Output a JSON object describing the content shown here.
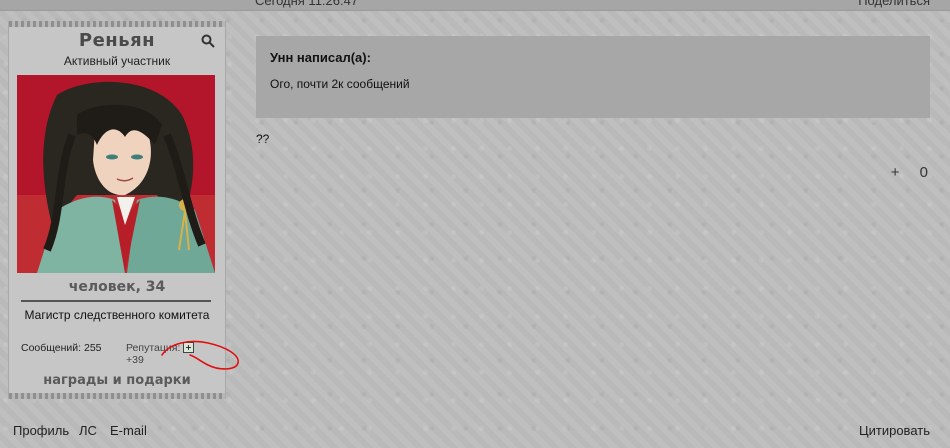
{
  "topbar": {
    "left_text": "Сегодня 11:26:47",
    "right_text": "Поделиться"
  },
  "profile": {
    "name": "Реньян",
    "rank": "Активный участник",
    "species": "человек, 34",
    "title": "Магистр следственного комитета",
    "posts_label": "Сообщений: 255",
    "reputation_label": "Репутация:",
    "reputation_value": "+39",
    "awards_label": "награды и подарки"
  },
  "post": {
    "quote_author": "Унн написал(а):",
    "quote_text": "Ого, почти 2к сообщений",
    "body": "??",
    "vote_plus": "+",
    "vote_count": "0"
  },
  "footer": {
    "profile_link": "Профиль",
    "pm_link": "ЛС",
    "email_link": "E-mail",
    "quote_link": "Цитировать"
  },
  "colors": {
    "annotation": "#e01010",
    "quote_bg": "#a7a7a7",
    "avatar_bg": "#b1122a"
  }
}
